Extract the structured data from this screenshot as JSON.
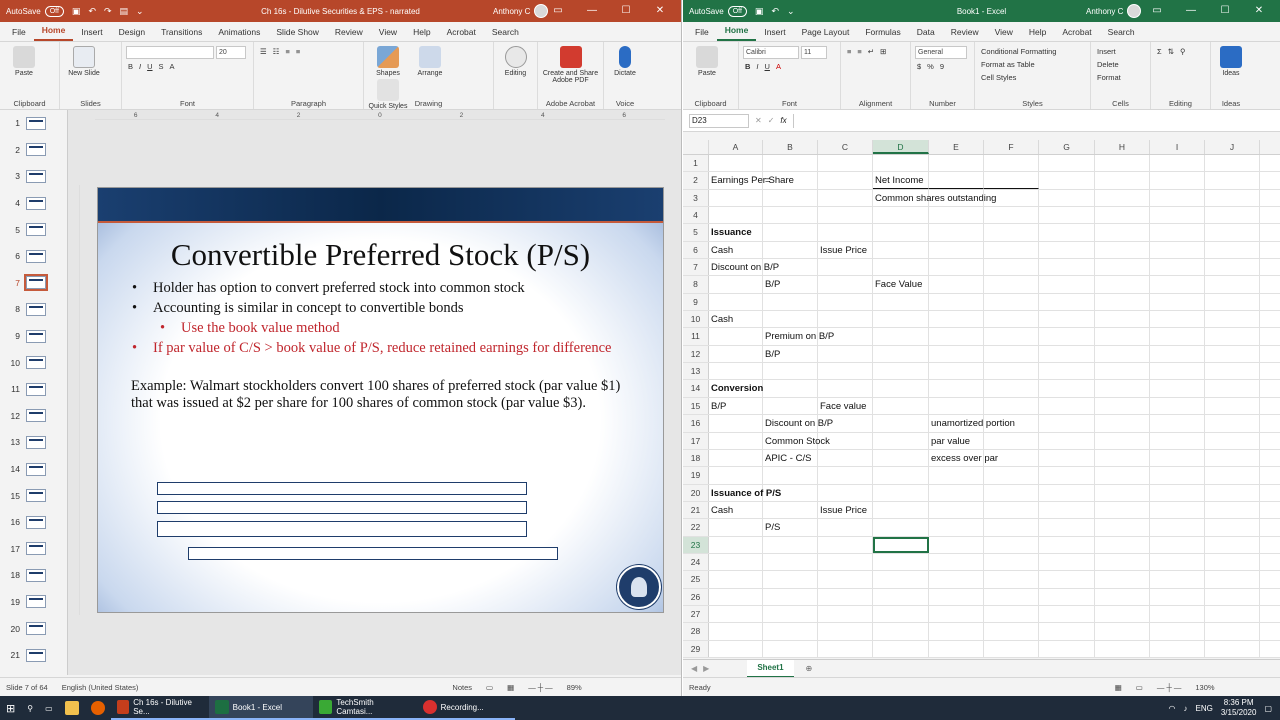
{
  "ppt": {
    "autosave": "AutoSave",
    "autosave_state": "Off",
    "title": "Ch 16s - Dilutive Securities & EPS - narrated",
    "user": "Anthony C",
    "tabs": [
      "File",
      "Home",
      "Insert",
      "Design",
      "Transitions",
      "Animations",
      "Slide Show",
      "Review",
      "View",
      "Help",
      "Acrobat",
      "Search"
    ],
    "groups": [
      "Clipboard",
      "Slides",
      "Font",
      "Paragraph",
      "Drawing",
      "Adobe Acrobat",
      "Voice"
    ],
    "buttons": {
      "paste": "Paste",
      "new_slide": "New Slide",
      "shapes": "Shapes",
      "arrange": "Arrange",
      "quick_styles": "Quick Styles",
      "editing": "Editing",
      "create_share": "Create and Share Adobe PDF",
      "dictate": "Dictate"
    },
    "font_size": "20",
    "slide_numbers": [
      "1",
      "2",
      "3",
      "4",
      "5",
      "6",
      "7",
      "8",
      "9",
      "10",
      "11",
      "12",
      "13",
      "14",
      "15",
      "16",
      "17",
      "18",
      "19",
      "20",
      "21"
    ],
    "ruler": [
      "6",
      "4",
      "2",
      "0",
      "2",
      "4",
      "6"
    ],
    "slide": {
      "title": "Convertible Preferred Stock (P/S)",
      "bullets": [
        "Holder has option to convert preferred stock into common stock",
        "Accounting is similar in concept to convertible bonds",
        "Use the book value method",
        "If par value of C/S > book value of P/S, reduce retained earnings for difference"
      ],
      "example": "Example: Walmart stockholders convert 100 shares of preferred stock (par value $1) that was issued at $2 per share for 100 shares of common stock (par value $3)."
    },
    "status": {
      "slide": "Slide 7 of 64",
      "lang": "English (United States)",
      "notes": "Notes",
      "zoom": "89%"
    }
  },
  "xl": {
    "autosave": "AutoSave",
    "autosave_state": "Off",
    "title": "Book1 - Excel",
    "user": "Anthony C",
    "tabs": [
      "File",
      "Home",
      "Insert",
      "Page Layout",
      "Formulas",
      "Data",
      "Review",
      "View",
      "Help",
      "Acrobat",
      "Search"
    ],
    "groups": [
      "Clipboard",
      "Font",
      "Alignment",
      "Number",
      "Styles",
      "Cells",
      "Editing",
      "Ideas"
    ],
    "buttons": {
      "paste": "Paste",
      "font": "Calibri",
      "font_size": "11",
      "number_format": "General",
      "cond_format": "Conditional Formatting",
      "format_table": "Format as Table",
      "cell_styles": "Cell Styles",
      "insert": "Insert",
      "delete": "Delete",
      "format": "Format",
      "ideas": "Ideas"
    },
    "name_box": "D23",
    "fx": "fx",
    "columns": [
      "A",
      "B",
      "C",
      "D",
      "E",
      "F",
      "G",
      "H",
      "I",
      "J"
    ],
    "rows": [
      {
        "n": "1",
        "cells": {}
      },
      {
        "n": "2",
        "cells": {
          "A": "Earnings Per Share",
          "B": "=",
          "D": "Net Income"
        }
      },
      {
        "n": "3",
        "cells": {
          "D": "Common shares outstanding"
        }
      },
      {
        "n": "4",
        "cells": {}
      },
      {
        "n": "5",
        "cells": {
          "A": "Issuance"
        }
      },
      {
        "n": "6",
        "cells": {
          "A": "Cash",
          "C": "Issue Price"
        }
      },
      {
        "n": "7",
        "cells": {
          "A": "Discount on B/P"
        }
      },
      {
        "n": "8",
        "cells": {
          "B": "B/P",
          "D": "Face Value"
        }
      },
      {
        "n": "9",
        "cells": {}
      },
      {
        "n": "10",
        "cells": {
          "A": "Cash"
        }
      },
      {
        "n": "11",
        "cells": {
          "B": "Premium on B/P"
        }
      },
      {
        "n": "12",
        "cells": {
          "B": "B/P"
        }
      },
      {
        "n": "13",
        "cells": {}
      },
      {
        "n": "14",
        "cells": {
          "A": "Conversion"
        }
      },
      {
        "n": "15",
        "cells": {
          "A": "B/P",
          "C": "Face value"
        }
      },
      {
        "n": "16",
        "cells": {
          "B": "Discount on B/P",
          "E": "unamortized portion"
        }
      },
      {
        "n": "17",
        "cells": {
          "B": "Common Stock",
          "E": "par value"
        }
      },
      {
        "n": "18",
        "cells": {
          "B": "APIC - C/S",
          "E": "excess over par"
        }
      },
      {
        "n": "19",
        "cells": {}
      },
      {
        "n": "20",
        "cells": {
          "A": "Issuance of P/S"
        }
      },
      {
        "n": "21",
        "cells": {
          "A": "Cash",
          "C": "Issue Price"
        }
      },
      {
        "n": "22",
        "cells": {
          "B": "P/S"
        }
      },
      {
        "n": "23",
        "cells": {}
      },
      {
        "n": "24",
        "cells": {}
      },
      {
        "n": "25",
        "cells": {}
      },
      {
        "n": "26",
        "cells": {}
      },
      {
        "n": "27",
        "cells": {}
      },
      {
        "n": "28",
        "cells": {}
      },
      {
        "n": "29",
        "cells": {}
      }
    ],
    "bold_cells": [
      "A5",
      "A14",
      "A20"
    ],
    "sheet_tab": "Sheet1",
    "status": {
      "ready": "Ready",
      "zoom": "130%"
    }
  },
  "taskbar": {
    "items": [
      "Ch 16s - Dilutive Se...",
      "Book1 - Excel",
      "TechSmith Camtasi...",
      "Recording..."
    ],
    "lang": "ENG",
    "time": "8:36 PM",
    "date": "3/15/2020"
  }
}
